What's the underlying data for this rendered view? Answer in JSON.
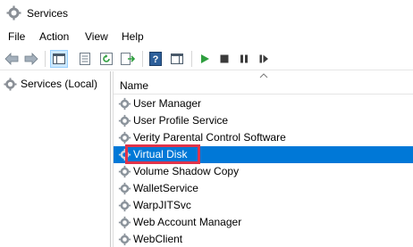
{
  "window": {
    "title": "Services"
  },
  "menu": [
    "File",
    "Action",
    "View",
    "Help"
  ],
  "toolbar": {
    "buttons": [
      "back-arrow-icon",
      "forward-arrow-icon",
      "show-console-tree-icon",
      "properties-icon",
      "refresh-icon",
      "export-list-icon",
      "help-icon",
      "show-action-pane-icon",
      "start-service-icon",
      "stop-service-icon",
      "pause-service-icon",
      "resume-service-icon"
    ]
  },
  "tree": {
    "root_label": "Services (Local)"
  },
  "list": {
    "column_name": "Name",
    "rows": [
      {
        "name": "User Manager",
        "selected": false
      },
      {
        "name": "User Profile Service",
        "selected": false
      },
      {
        "name": "Verity Parental Control Software",
        "selected": false
      },
      {
        "name": "Virtual Disk",
        "selected": true
      },
      {
        "name": "Volume Shadow Copy",
        "selected": false
      },
      {
        "name": "WalletService",
        "selected": false
      },
      {
        "name": "WarpJITSvc",
        "selected": false
      },
      {
        "name": "Web Account Manager",
        "selected": false
      },
      {
        "name": "WebClient",
        "selected": false
      }
    ]
  },
  "colors": {
    "selection": "#0078d7",
    "highlight_outline": "#e0334a",
    "play_green": "#2e9e3e"
  }
}
